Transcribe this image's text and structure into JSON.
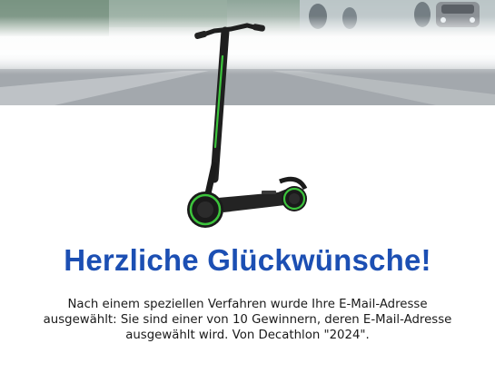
{
  "email": {
    "headline": "Herzliche Glückwünsche!",
    "body_line_1": "Nach einem speziellen Verfahren wurde Ihre E-Mail-Adresse",
    "body_line_2": "ausgewählt: Sie sind einer von 10 Gewinnern, deren E-Mail-Adresse",
    "body_line_3": "ausgewählt wird. Von Decathlon \"2024\"."
  },
  "colors": {
    "headline": "#1c4fb3",
    "scooter_accent": "#3cc43c"
  }
}
